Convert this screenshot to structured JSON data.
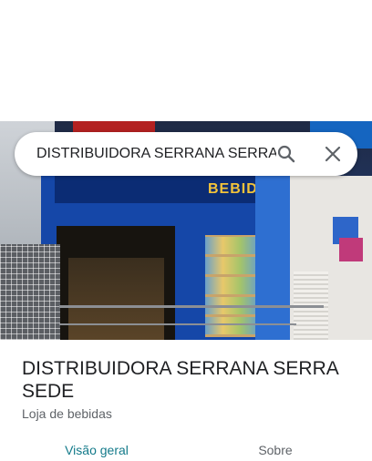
{
  "search": {
    "query": "DISTRIBUIDORA SERRANA SERRA SEDE",
    "search_icon": "search-icon",
    "close_icon": "close-icon"
  },
  "place": {
    "name": "DISTRIBUIDORA SERRANA SERRA SEDE",
    "category": "Loja de bebidas",
    "photo_sign_text": "BEBIDAS"
  },
  "tabs": [
    {
      "label": "Visão geral",
      "active": true
    },
    {
      "label": "Sobre",
      "active": false
    }
  ],
  "colors": {
    "active_tab": "#137a8a",
    "inactive_tab": "#5f6368",
    "title": "#202124"
  }
}
